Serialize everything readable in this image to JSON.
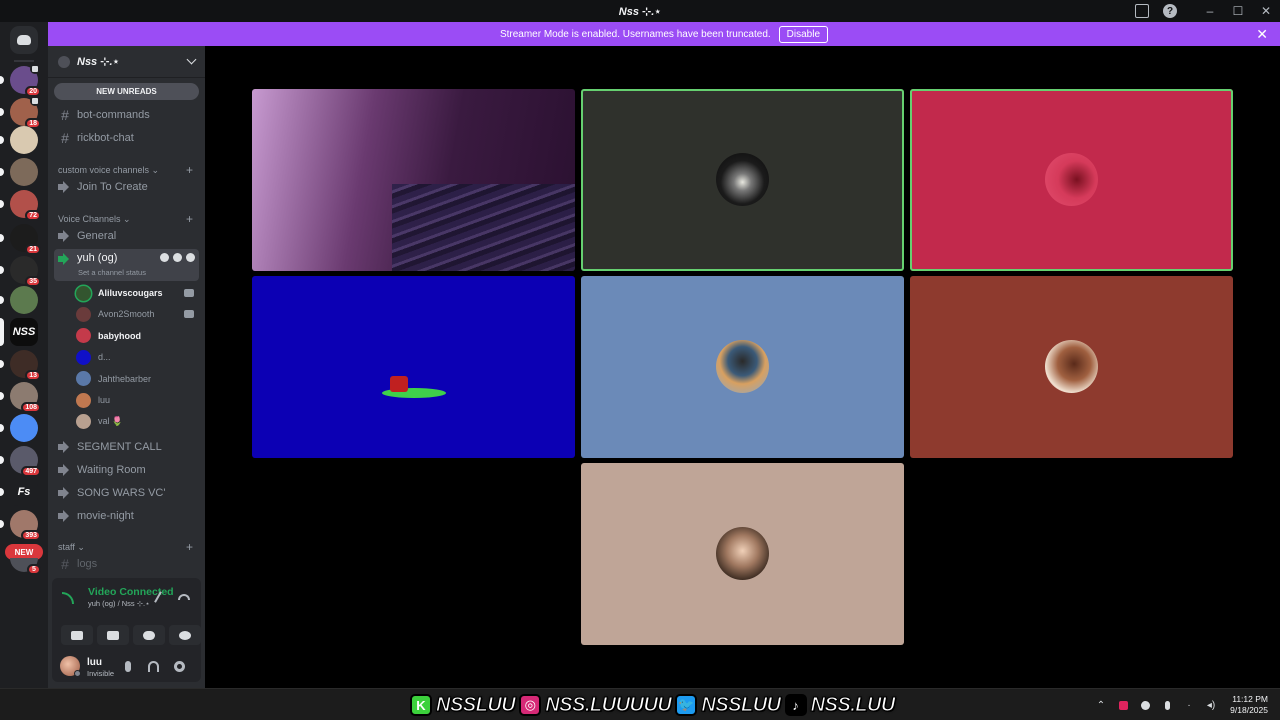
{
  "window": {
    "title": "Nss ⊹.⋆",
    "controls": [
      "–",
      "☐",
      "✕"
    ]
  },
  "banner": {
    "text": "Streamer Mode is enabled. Usernames have been truncated.",
    "button": "Disable",
    "close": "✕"
  },
  "rail": {
    "servers": [
      {
        "badge": "20",
        "color": "#6a4d8c",
        "volume": true
      },
      {
        "badge": "18",
        "color": "#a0614b",
        "volume": true
      },
      {
        "badge": "",
        "color": "#d9c9b0",
        "volume": false
      },
      {
        "badge": "",
        "color": "#7d6a5a",
        "volume": false
      },
      {
        "badge": "72",
        "color": "#b2504a",
        "volume": false
      },
      {
        "badge": "21",
        "color": "#1c1c1c",
        "volume": false
      },
      {
        "badge": "35",
        "color": "#2a2a2a",
        "volume": false
      },
      {
        "badge": "",
        "color": "#5c7a4e",
        "volume": false
      },
      {
        "badge": "",
        "color": "#0d0d0d",
        "volume": false,
        "label": "NSS",
        "selected": true
      },
      {
        "badge": "13",
        "color": "#3e2c26",
        "volume": false
      },
      {
        "badge": "108",
        "color": "#8c7b70",
        "volume": false
      },
      {
        "badge": "",
        "color": "#4c8cf5",
        "volume": false
      },
      {
        "badge": "497",
        "color": "#5a5a6a",
        "volume": false
      },
      {
        "badge": "",
        "color": "#1e1f22",
        "volume": false,
        "label": "Fs"
      },
      {
        "badge": "393",
        "color": "#a0786a",
        "volume": false
      }
    ],
    "new_pill": "NEW",
    "new_badge": "5"
  },
  "sidebar": {
    "guild_name": "Nss ⊹.⋆",
    "new_unreads": "NEW UNREADS",
    "text_channels": [
      "bot-commands",
      "rickbot-chat"
    ],
    "category_custom": "custom voice channels",
    "custom_channels": [
      "Join To Create"
    ],
    "category_voice": "Voice Channels",
    "voice_general": "General",
    "active_channel": {
      "name": "yuh (og)",
      "status": "Set a channel status"
    },
    "members": [
      {
        "name": "Aliluvscougars",
        "bold": true,
        "color": "#33552f",
        "speaking": true,
        "tail": true
      },
      {
        "name": "Avon2Smooth",
        "bold": false,
        "color": "#6a3b3b",
        "speaking": false,
        "tail": true
      },
      {
        "name": "babyhood",
        "bold": true,
        "color": "#c43a4a",
        "speaking": false,
        "tail": false
      },
      {
        "name": "d...",
        "bold": false,
        "color": "#1010c8",
        "speaking": false,
        "tail": false
      },
      {
        "name": "Jahthebarber",
        "bold": false,
        "color": "#5a78a8",
        "speaking": false,
        "tail": false
      },
      {
        "name": "luu",
        "bold": false,
        "color": "#c07850",
        "speaking": false,
        "tail": false
      },
      {
        "name": "val",
        "bold": false,
        "color": "#b8a090",
        "speaking": false,
        "tail": false,
        "heart": "🌷"
      }
    ],
    "more_voice": [
      "SEGMENT CALL",
      "Waiting Room",
      "SONG WARS VC'",
      "movie-night"
    ],
    "category_staff": "staff",
    "staff_channels": [
      "logs"
    ]
  },
  "voice_panel": {
    "state": "Video Connected",
    "location": "yuh (og) / Nss ⊹.⋆"
  },
  "user": {
    "name": "luu",
    "status": "Invisible"
  },
  "tiles": [
    {
      "bg": "linear-gradient(100deg,#c79ad0 0%,#6a3a70 35%,#3a1a40 60%,#2a1030 100%)",
      "avatar": "",
      "speaking": false
    },
    {
      "bg": "#2f312c",
      "avatar": "radial-gradient(circle at 50% 55%,#e8e8e0 0%,#777 22%,#1b1b1b 55%,#0a0a0a 100%)",
      "speaking": true
    },
    {
      "bg": "#c2294c",
      "avatar": "radial-gradient(circle at 60% 50%,#7a1020 0%,#d53a5a 45%,#e24d6e 100%)",
      "speaking": true
    },
    {
      "bg": "#0c00b4",
      "avatar": "",
      "speaking": false
    },
    {
      "bg": "#6b8ab8",
      "avatar": "radial-gradient(circle at 50% 40%,#2a2a2a 0%,#3b5a78 35%,#d8a060 55%,#8aa8c8 100%)",
      "speaking": false
    },
    {
      "bg": "#8e3a2e",
      "avatar": "radial-gradient(circle at 55% 45%,#5a2a1a 0%,#a06040 40%,#f0e0d0 70%,#d02020 100%)",
      "speaking": false
    },
    {
      "bg": "#bfa597",
      "avatar": "radial-gradient(circle at 50% 45%,#f0d0b8 0%,#a07860 40%,#3a2a20 75%,#e0e0e0 100%)",
      "speaking": false
    }
  ],
  "socials": [
    {
      "icon": "K",
      "color": "#3cd13c",
      "handle": "NSSLUU"
    },
    {
      "icon": "◎",
      "color": "#d62976",
      "handle": "NSS.LUUUUU"
    },
    {
      "icon": "🐦",
      "color": "#1d9bf0",
      "handle": "NSSLUU"
    },
    {
      "icon": "♪",
      "color": "#000000",
      "handle": "NSS.LUU"
    }
  ],
  "clock": {
    "time": "11:12 PM",
    "date": "9/18/2025"
  }
}
